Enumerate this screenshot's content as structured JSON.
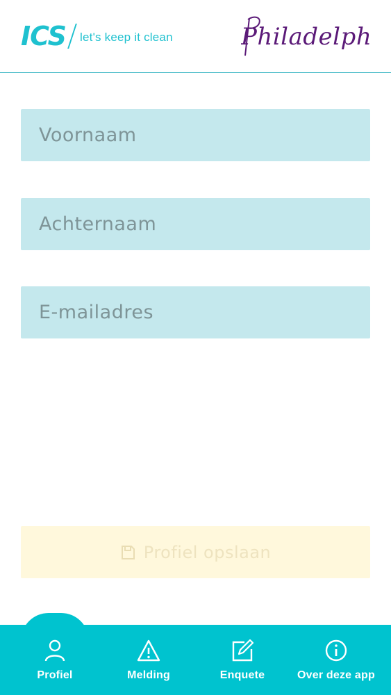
{
  "header": {
    "ics_mark": "ICS",
    "ics_tagline": "let's keep it clean",
    "brand_name": "Philadelphia"
  },
  "form": {
    "first_name_placeholder": "Voornaam",
    "last_name_placeholder": "Achternaam",
    "email_placeholder": "E-mailadres",
    "save_label": "Profiel opslaan",
    "save_icon": "floppy-disk-icon"
  },
  "nav": {
    "items": [
      {
        "label": "Profiel",
        "icon": "user-icon",
        "active": true
      },
      {
        "label": "Melding",
        "icon": "warning-icon"
      },
      {
        "label": "Enquete",
        "icon": "edit-icon"
      },
      {
        "label": "Over deze app",
        "icon": "info-icon"
      }
    ]
  },
  "colors": {
    "accent": "#00c3cf",
    "field_bg": "#c4e8ed",
    "save_bg": "#fff8dc",
    "brand_purple": "#5b1a78"
  }
}
